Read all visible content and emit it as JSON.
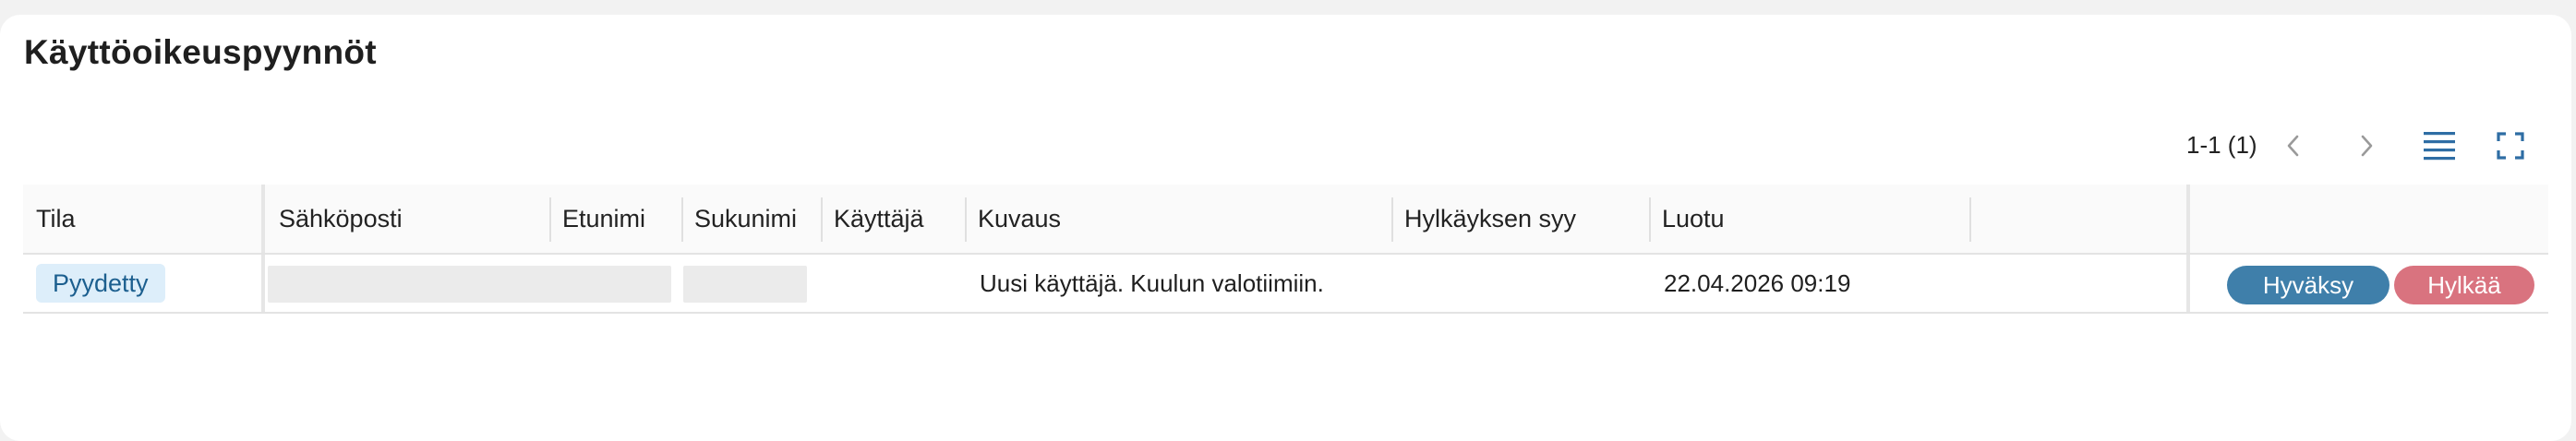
{
  "page": {
    "title": "Käyttöoikeuspyynnöt"
  },
  "toolbar": {
    "pagination_text": "1-1 (1)",
    "icons": [
      "chevron-left-icon",
      "chevron-right-icon",
      "density-icon",
      "fullscreen-icon"
    ]
  },
  "table": {
    "columns": [
      "Tila",
      "Sähköposti",
      "Etunimi",
      "Sukunimi",
      "Käyttäjä",
      "Kuvaus",
      "Hylkäyksen syy",
      "Luotu"
    ],
    "rows": [
      {
        "status": "Pyydetty",
        "email": "",
        "first_name": "",
        "last_name": "",
        "user": "",
        "description": "Uusi käyttäjä. Kuulun valotiimiin.",
        "rejection_reason": "",
        "created": "22.04.2026 09:19",
        "actions": {
          "approve": "Hyväksy",
          "reject": "Hylkää"
        }
      }
    ]
  },
  "colors": {
    "accent": "#2e6da4",
    "approve": "#3f7faa",
    "reject": "#d9737f",
    "chip_bg": "#ddeefa"
  }
}
